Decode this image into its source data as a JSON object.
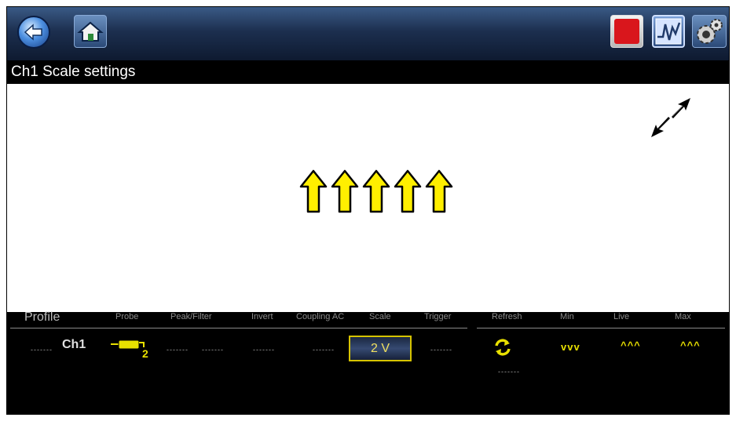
{
  "title": "Ch1 Scale settings",
  "toolbar": {
    "icons": [
      "back-icon",
      "home-icon",
      "stop-icon",
      "scope-icon",
      "settings-icon"
    ]
  },
  "panel": {
    "headers": {
      "profile": "Profile",
      "probe": "Probe",
      "peak_filter": "Peak/Filter",
      "invert": "Invert",
      "coupling": "Coupling AC",
      "scale": "Scale",
      "trigger": "Trigger",
      "refresh": "Refresh",
      "min": "Min",
      "live": "Live",
      "max": "Max"
    },
    "row": {
      "channel": "Ch1",
      "placeholder": "-------",
      "scale": "2 V",
      "min": "vvv",
      "live": "^^^",
      "max": "^^^"
    }
  },
  "colors": {
    "highlight_yellow": "#f0e800",
    "toolbar_blue": "#1c2f4f"
  }
}
